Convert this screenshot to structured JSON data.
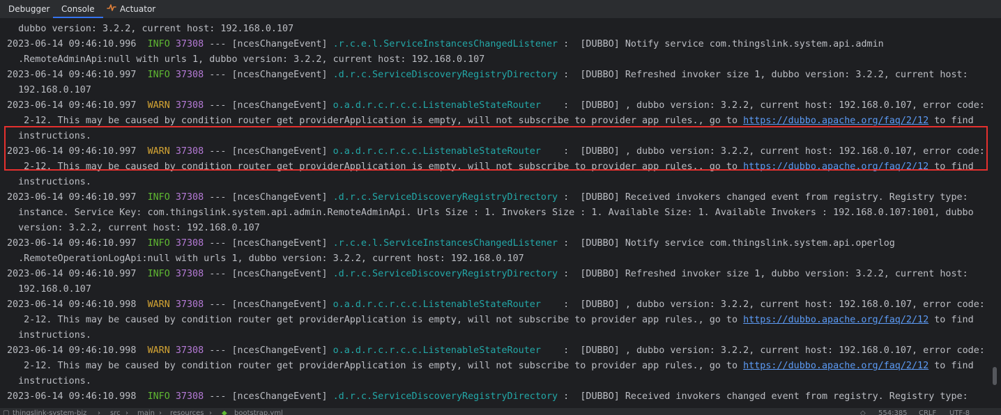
{
  "tabs": [
    {
      "label": "Debugger",
      "active": false
    },
    {
      "label": "Console",
      "active": true
    },
    {
      "label": "Actuator",
      "active": false,
      "icon": "actuator-icon"
    }
  ],
  "colors": {
    "info": "#5fb832",
    "warn": "#d5a534",
    "pid": "#b57ad6",
    "logger": "#23a8a8",
    "link": "#5c9bf5",
    "highlight_border": "#e5302e"
  },
  "console_lines": [
    {
      "text": "  dubbo version: 3.2.2, current host: 192.168.0.107"
    },
    {
      "time": "2023-06-14 09:46:10.996",
      "level": "INFO",
      "pid": "37308",
      "thread": " --- [ncesChangeEvent] ",
      "logger": ".r.c.e.l.ServiceInstancesChangedListener",
      "sep": " :  ",
      "msg": "[DUBBO] Notify service com.thingslink.system.api.admin"
    },
    {
      "text": "  .RemoteAdminApi:null with urls 1, dubbo version: 3.2.2, current host: 192.168.0.107"
    },
    {
      "time": "2023-06-14 09:46:10.997",
      "level": "INFO",
      "pid": "37308",
      "thread": " --- [ncesChangeEvent] ",
      "logger": ".d.r.c.ServiceDiscoveryRegistryDirectory",
      "sep": " :  ",
      "msg": "[DUBBO] Refreshed invoker size 1, dubbo version: 3.2.2, current host:"
    },
    {
      "text": "  192.168.0.107"
    },
    {
      "time": "2023-06-14 09:46:10.997",
      "level": "WARN",
      "pid": "37308",
      "thread": " --- [ncesChangeEvent] ",
      "logger": "o.a.d.r.c.r.c.c.ListenableStateRouter   ",
      "sep": " :  ",
      "msg": "[DUBBO] , dubbo version: 3.2.2, current host: 192.168.0.107, error code:"
    },
    {
      "text": "   2-12. This may be caused by condition router get providerApplication is empty, will not subscribe to provider app rules., go to ",
      "link": "https://dubbo.apache.org/faq/2/12",
      "after": " to find"
    },
    {
      "text": "  instructions."
    },
    {
      "time": "2023-06-14 09:46:10.997",
      "level": "WARN",
      "pid": "37308",
      "thread": " --- [ncesChangeEvent] ",
      "logger": "o.a.d.r.c.r.c.c.ListenableStateRouter   ",
      "sep": " :  ",
      "msg": "[DUBBO] , dubbo version: 3.2.2, current host: 192.168.0.107, error code:"
    },
    {
      "text": "   2-12. This may be caused by condition router get providerApplication is empty, will not subscribe to provider app rules., go to ",
      "link": "https://dubbo.apache.org/faq/2/12",
      "after": " to find"
    },
    {
      "text": "  instructions."
    },
    {
      "time": "2023-06-14 09:46:10.997",
      "level": "INFO",
      "pid": "37308",
      "thread": " --- [ncesChangeEvent] ",
      "logger": ".d.r.c.ServiceDiscoveryRegistryDirectory",
      "sep": " :  ",
      "msg": "[DUBBO] Received invokers changed event from registry. Registry type:"
    },
    {
      "text": "  instance. Service Key: com.thingslink.system.api.admin.RemoteAdminApi. Urls Size : 1. Invokers Size : 1. Available Size: 1. Available Invokers : 192.168.0.107:1001, dubbo"
    },
    {
      "text": "  version: 3.2.2, current host: 192.168.0.107"
    },
    {
      "time": "2023-06-14 09:46:10.997",
      "level": "INFO",
      "pid": "37308",
      "thread": " --- [ncesChangeEvent] ",
      "logger": ".r.c.e.l.ServiceInstancesChangedListener",
      "sep": " :  ",
      "msg": "[DUBBO] Notify service com.thingslink.system.api.operlog"
    },
    {
      "text": "  .RemoteOperationLogApi:null with urls 1, dubbo version: 3.2.2, current host: 192.168.0.107"
    },
    {
      "time": "2023-06-14 09:46:10.997",
      "level": "INFO",
      "pid": "37308",
      "thread": " --- [ncesChangeEvent] ",
      "logger": ".d.r.c.ServiceDiscoveryRegistryDirectory",
      "sep": " :  ",
      "msg": "[DUBBO] Refreshed invoker size 1, dubbo version: 3.2.2, current host:"
    },
    {
      "text": "  192.168.0.107"
    },
    {
      "time": "2023-06-14 09:46:10.998",
      "level": "WARN",
      "pid": "37308",
      "thread": " --- [ncesChangeEvent] ",
      "logger": "o.a.d.r.c.r.c.c.ListenableStateRouter   ",
      "sep": " :  ",
      "msg": "[DUBBO] , dubbo version: 3.2.2, current host: 192.168.0.107, error code:"
    },
    {
      "text": "   2-12. This may be caused by condition router get providerApplication is empty, will not subscribe to provider app rules., go to ",
      "link": "https://dubbo.apache.org/faq/2/12",
      "after": " to find"
    },
    {
      "text": "  instructions."
    },
    {
      "time": "2023-06-14 09:46:10.998",
      "level": "WARN",
      "pid": "37308",
      "thread": " --- [ncesChangeEvent] ",
      "logger": "o.a.d.r.c.r.c.c.ListenableStateRouter   ",
      "sep": " :  ",
      "msg": "[DUBBO] , dubbo version: 3.2.2, current host: 192.168.0.107, error code:"
    },
    {
      "text": "   2-12. This may be caused by condition router get providerApplication is empty, will not subscribe to provider app rules., go to ",
      "link": "https://dubbo.apache.org/faq/2/12",
      "after": " to find"
    },
    {
      "text": "  instructions."
    },
    {
      "time": "2023-06-14 09:46:10.998",
      "level": "INFO",
      "pid": "37308",
      "thread": " --- [ncesChangeEvent] ",
      "logger": ".d.r.c.ServiceDiscoveryRegistryDirectory",
      "sep": " :  ",
      "msg": "[DUBBO] Received invokers changed event from registry. Registry type:"
    }
  ],
  "status_bar": {
    "breadcrumb": [
      "thingslink-system-biz",
      "src",
      "main",
      "resources",
      "bootstrap.yml"
    ],
    "position": "554:385",
    "line_ending": "CRLF",
    "encoding": "UTF-8"
  }
}
